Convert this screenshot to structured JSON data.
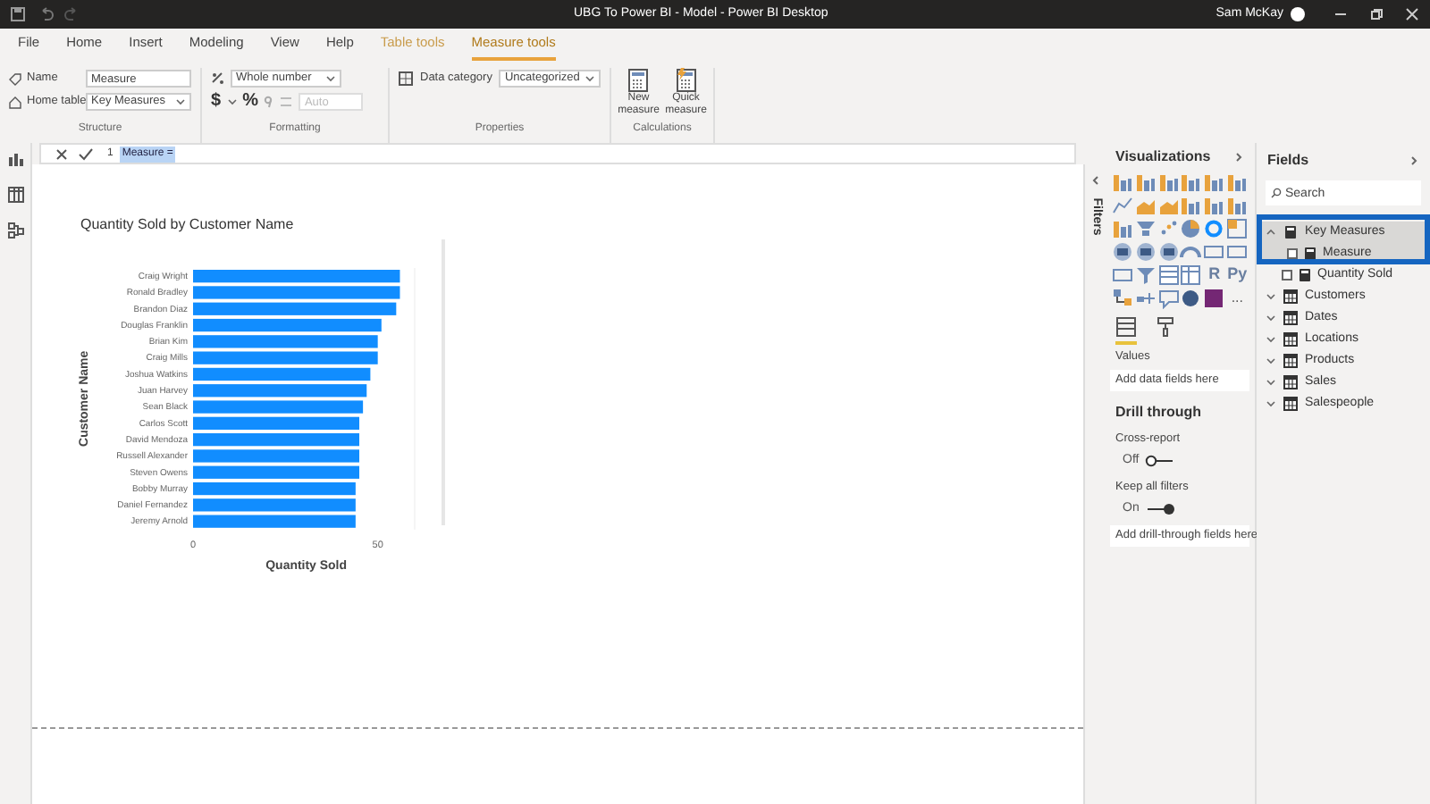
{
  "window": {
    "title": "UBG To Power BI - Model - Power BI Desktop",
    "user": "Sam McKay"
  },
  "menu_tabs": [
    {
      "label": "File",
      "kind": "plain",
      "selected": false
    },
    {
      "label": "Home",
      "kind": "plain",
      "selected": false
    },
    {
      "label": "Insert",
      "kind": "plain",
      "selected": false
    },
    {
      "label": "Modeling",
      "kind": "plain",
      "selected": false
    },
    {
      "label": "View",
      "kind": "plain",
      "selected": false
    },
    {
      "label": "Help",
      "kind": "plain",
      "selected": false
    },
    {
      "label": "Table tools",
      "kind": "contextual",
      "selected": false
    },
    {
      "label": "Measure tools",
      "kind": "contextual",
      "selected": true
    }
  ],
  "ribbon": {
    "structure": {
      "name_label": "Name",
      "name_value": "Measure",
      "home_table_label": "Home table",
      "home_table_value": "Key Measures",
      "caption": "Structure"
    },
    "formatting": {
      "format_value": "Whole number",
      "currency": "$",
      "percent": "%",
      "decimals_placeholder": "Auto",
      "caption": "Formatting"
    },
    "properties": {
      "data_category_label": "Data category",
      "data_category_value": "Uncategorized",
      "caption": "Properties"
    },
    "calculations": {
      "buttons": [
        {
          "label": "New measure",
          "kind": "new"
        },
        {
          "label": "Quick measure",
          "kind": "quick"
        }
      ],
      "caption": "Calculations"
    }
  },
  "formula": {
    "line_number": "1",
    "text": "Measure ="
  },
  "nav": [
    {
      "kind": "report",
      "selected": false
    },
    {
      "kind": "data",
      "selected": false
    },
    {
      "kind": "model",
      "selected": false
    }
  ],
  "chart": {
    "chart_data": {
      "type": "bar",
      "orientation": "horizontal",
      "title": "Quantity Sold by Customer Name",
      "xlabel": "Quantity Sold",
      "ylabel": "Customer Name",
      "xlim": [
        0,
        60
      ],
      "xticks": [
        0,
        50
      ],
      "categories": [
        "Craig Wright",
        "Ronald Bradley",
        "Brandon Diaz",
        "Douglas Franklin",
        "Brian Kim",
        "Craig Mills",
        "Joshua Watkins",
        "Juan Harvey",
        "Sean Black",
        "Carlos Scott",
        "David Mendoza",
        "Russell Alexander",
        "Steven Owens",
        "Bobby Murray",
        "Daniel Fernandez",
        "Jeremy Arnold"
      ],
      "series": [
        {
          "color": "#118dff",
          "values": [
            56,
            56,
            55,
            51,
            50,
            50,
            48,
            47,
            46,
            45,
            45,
            45,
            45,
            44,
            44,
            44
          ]
        }
      ]
    }
  },
  "filters": {
    "label": "Filters"
  },
  "visualizations": {
    "title": "Visualizations",
    "icons": [
      {
        "kind": "bar"
      },
      {
        "kind": "bar"
      },
      {
        "kind": "bar"
      },
      {
        "kind": "bar"
      },
      {
        "kind": "bar"
      },
      {
        "kind": "bar"
      },
      {
        "kind": "line"
      },
      {
        "kind": "area"
      },
      {
        "kind": "area"
      },
      {
        "kind": "bar"
      },
      {
        "kind": "bar"
      },
      {
        "kind": "bar"
      },
      {
        "kind": "bar"
      },
      {
        "kind": "funnel"
      },
      {
        "kind": "scatter"
      },
      {
        "kind": "pie"
      },
      {
        "kind": "donut"
      },
      {
        "kind": "grid"
      },
      {
        "kind": "map"
      },
      {
        "kind": "map"
      },
      {
        "kind": "map"
      },
      {
        "kind": "gauge"
      },
      {
        "kind": "card"
      },
      {
        "kind": "card"
      },
      {
        "kind": "card"
      },
      {
        "kind": "slicer"
      },
      {
        "kind": "table"
      },
      {
        "kind": "matrix"
      },
      {
        "kind": "text",
        "label": "R"
      },
      {
        "kind": "text",
        "label": "Py"
      },
      {
        "kind": "tree"
      },
      {
        "kind": "key"
      },
      {
        "kind": "qa"
      },
      {
        "kind": "globe"
      },
      {
        "kind": "apps"
      },
      {
        "kind": "more",
        "label": "..."
      }
    ],
    "tabs": [
      {
        "kind": "fields",
        "selected": true
      },
      {
        "kind": "format",
        "selected": false
      }
    ],
    "values_label": "Values",
    "values_placeholder": "Add data fields here",
    "drill_title": "Drill through",
    "cross_report_label": "Cross-report",
    "cross_report": {
      "label": "Off",
      "on": false
    },
    "keep_filters_label": "Keep all filters",
    "keep_filters": {
      "label": "On",
      "on": true
    },
    "drill_placeholder": "Add drill-through fields here"
  },
  "fields": {
    "title": "Fields",
    "search": {
      "placeholder": "Search"
    },
    "tables": [
      {
        "name": "Key Measures",
        "kind": "measures",
        "expanded": true,
        "children": [
          {
            "name": "Measure",
            "selected": true,
            "checked": false
          },
          {
            "name": "Quantity Sold",
            "selected": false,
            "checked": false
          }
        ]
      },
      {
        "name": "Customers",
        "kind": "table",
        "expanded": false
      },
      {
        "name": "Dates",
        "kind": "table",
        "expanded": false
      },
      {
        "name": "Locations",
        "kind": "table",
        "expanded": false
      },
      {
        "name": "Products",
        "kind": "table",
        "expanded": false
      },
      {
        "name": "Sales",
        "kind": "table",
        "expanded": false
      },
      {
        "name": "Salespeople",
        "kind": "table",
        "expanded": false
      }
    ]
  }
}
